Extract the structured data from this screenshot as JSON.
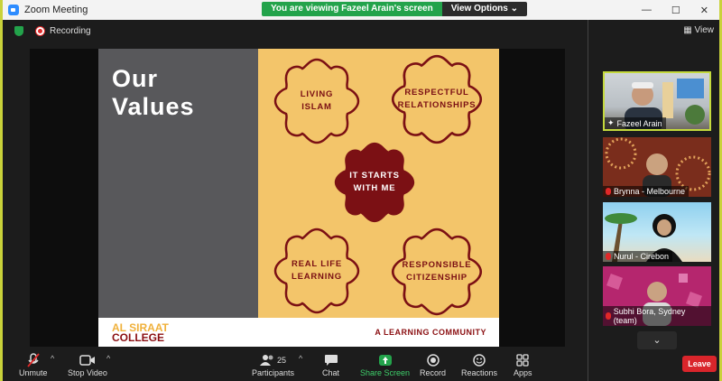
{
  "window": {
    "title": "Zoom Meeting",
    "controls": [
      "—",
      "☐",
      "✕"
    ]
  },
  "banner": {
    "message": "You are viewing Fazeel Arain's screen",
    "options_label": "View Options ⌄"
  },
  "status": {
    "recording_label": "Recording"
  },
  "slide": {
    "title": "Our\nValues",
    "values": {
      "living_islam": "LIVING\nISLAM",
      "respectful_relationships": "RESPECTFUL\nRELATIONSHIPS",
      "center": "IT STARTS\nWITH ME",
      "real_life_learning": "REAL LIFE\nLEARNING",
      "responsible_citizenship": "RESPONSIBLE\nCITIZENSHIP"
    },
    "college_line1": "AL SIRAAT",
    "college_line2": "COLLEGE",
    "community": "A LEARNING COMMUNITY"
  },
  "panel": {
    "view_label": "View",
    "participants": [
      {
        "name": "Fazeel Arain",
        "active": true
      },
      {
        "name": "Brynna - Melbourne",
        "muted": true
      },
      {
        "name": "Nurul - Cirebon",
        "muted": true
      },
      {
        "name": "Subhi Bora, Sydney (team)",
        "muted": true
      }
    ],
    "scroll_down": "⌄",
    "leave_label": "Leave"
  },
  "toolbar": {
    "unmute": "Unmute",
    "stop_video": "Stop Video",
    "participants": "Participants",
    "participants_count": "25",
    "chat": "Chat",
    "share_screen": "Share Screen",
    "record": "Record",
    "reactions": "Reactions",
    "apps": "Apps"
  },
  "colors": {
    "brand_blue": "#2d8cff",
    "banner_green": "#23a34b",
    "leave_red": "#d9252b",
    "slide_maroon": "#7b1014",
    "slide_yellow": "#f3c56a"
  }
}
